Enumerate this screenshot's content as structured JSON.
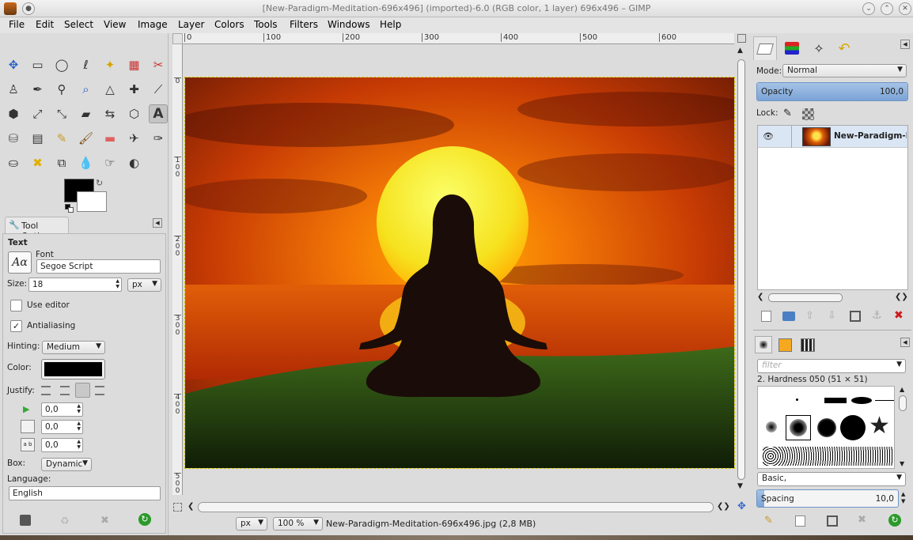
{
  "window": {
    "title": "[New-Paradigm-Meditation-696x496] (imported)-6.0 (RGB color, 1 layer) 696x496 – GIMP"
  },
  "menu": [
    "File",
    "Edit",
    "Select",
    "View",
    "Image",
    "Layer",
    "Colors",
    "Tools",
    "Filters",
    "Windows",
    "Help"
  ],
  "toolbox": {
    "tools": [
      "move",
      "rect-select",
      "ellipse-select",
      "free-select",
      "fuzzy-select",
      "select-by-color",
      "scissors",
      "foreground-select",
      "paths",
      "color-picker",
      "zoom",
      "measure",
      "align",
      "crop",
      "unified-transform",
      "rotate",
      "scale",
      "shear",
      "flip",
      "cage-transform",
      "text",
      "bucket-fill",
      "blend",
      "pencil",
      "paintbrush",
      "eraser",
      "airbrush",
      "ink",
      "clone",
      "heal",
      "perspective-clone",
      "blur",
      "smudge",
      "dodge-burn"
    ],
    "active_tool": "text",
    "fg_color": "#000000",
    "bg_color": "#ffffff"
  },
  "tool_options": {
    "tab_label": "Tool Options",
    "section": "Text",
    "font_label": "Font",
    "font_value": "Segoe Script",
    "font_preview": "Aα",
    "size_label": "Size:",
    "size_value": "18",
    "size_unit": "px",
    "use_editor_label": "Use editor",
    "use_editor": false,
    "antialiasing_label": "Antialiasing",
    "antialiasing": true,
    "hinting_label": "Hinting:",
    "hinting_value": "Medium",
    "color_label": "Color:",
    "color_value": "#000000",
    "justify_label": "Justify:",
    "indent_value": "0,0",
    "line_spacing_value": "0,0",
    "letter_spacing_value": "0,0",
    "letter_spacing_icon": "a b",
    "box_label": "Box:",
    "box_value": "Dynamic",
    "language_label": "Language:",
    "language_value": "English"
  },
  "rulers": {
    "top": [
      "0",
      "100",
      "200",
      "300",
      "400",
      "500",
      "600"
    ],
    "left": [
      "0",
      "100",
      "200",
      "300",
      "400",
      "500"
    ]
  },
  "status": {
    "unit": "px",
    "zoom": "100 %",
    "file_info": "New-Paradigm-Meditation-696x496.jpg (2,8 MB)"
  },
  "layers": {
    "mode_label": "Mode:",
    "mode_value": "Normal",
    "opacity_label": "Opacity",
    "opacity_value": "100,0",
    "lock_label": "Lock:",
    "layer_name": "New-Paradigm-Med"
  },
  "brushes": {
    "filter_placeholder": "filter",
    "selected_brush": "2. Hardness 050 (51 × 51)",
    "tag_value": "Basic,",
    "spacing_label": "Spacing",
    "spacing_value": "10,0"
  }
}
